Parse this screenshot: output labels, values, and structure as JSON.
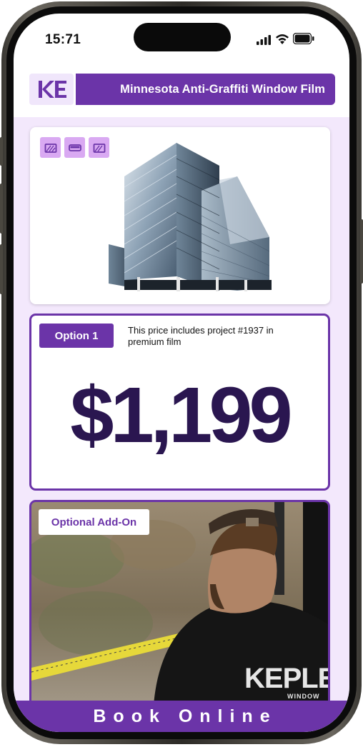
{
  "status_bar": {
    "time": "15:71",
    "icons": [
      "signal-icon",
      "wifi-icon",
      "battery-icon"
    ]
  },
  "header": {
    "logo": "KE",
    "title": "Minnesota Anti-Graffiti Window Film"
  },
  "product_card": {
    "icons": [
      "window-film-icon",
      "tint-icon",
      "window-film-icon"
    ]
  },
  "price_card": {
    "option_label": "Option 1",
    "description": "This price includes project #1937 in premium film",
    "price": "$1,199"
  },
  "addon_card": {
    "label": "Optional Add-On",
    "shirt_text": "KEPLE",
    "shirt_subtext": "WINDOW"
  },
  "cta": {
    "label": "Book Online"
  },
  "colors": {
    "brand_purple": "#6b34a8",
    "price_text": "#2a1650",
    "icon_tile": "#d9a9f2",
    "background": "#f3e8fc"
  }
}
